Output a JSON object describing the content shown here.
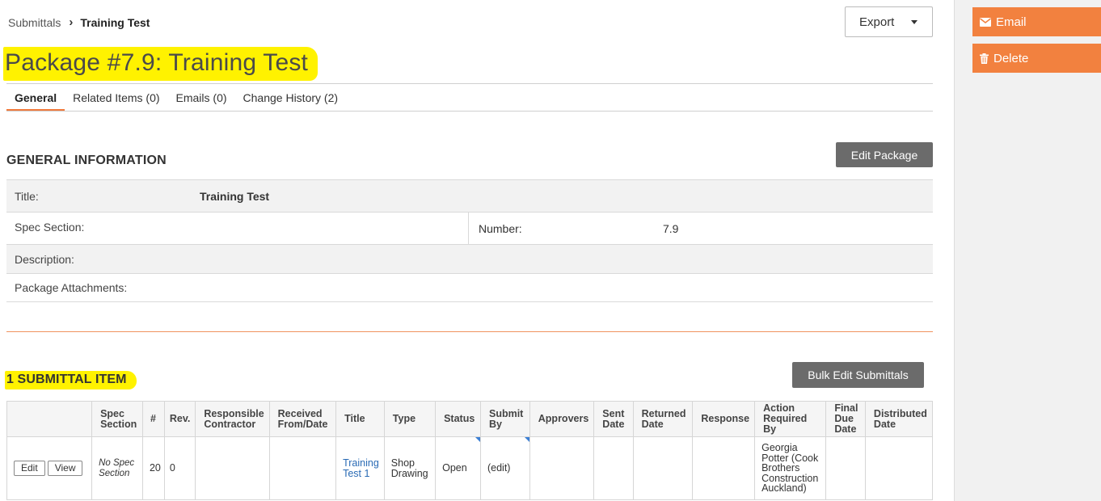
{
  "breadcrumb": {
    "parent": "Submittals",
    "current": "Training Test"
  },
  "export_label": "Export",
  "page_title": "Package #7.9: Training Test",
  "tabs": [
    {
      "label": "General"
    },
    {
      "label": "Related Items (0)"
    },
    {
      "label": "Emails (0)"
    },
    {
      "label": "Change History (2)"
    }
  ],
  "general": {
    "heading": "GENERAL INFORMATION",
    "edit_label": "Edit Package",
    "title_label": "Title:",
    "title_value": "Training Test",
    "spec_label": "Spec Section:",
    "number_label": "Number:",
    "number_value": "7.9",
    "description_label": "Description:",
    "attachments_label": "Package Attachments:"
  },
  "items": {
    "heading": "1 SUBMITTAL ITEM",
    "bulk_edit_label": "Bulk Edit Submittals",
    "columns": [
      "Spec Section",
      "#",
      "Rev.",
      "Responsible Contractor",
      "Received From/Date",
      "Title",
      "Type",
      "Status",
      "Submit By",
      "Approvers",
      "Sent Date",
      "Returned Date",
      "Response",
      "Action Required By",
      "Final Due Date",
      "Distributed Date"
    ],
    "row": {
      "edit": "Edit",
      "view": "View",
      "spec": "No Spec Section",
      "num": "20",
      "rev": "0",
      "responsible": "",
      "received": "",
      "title": "Training Test 1",
      "type": "Shop Drawing",
      "status": "Open",
      "submit_by": "(edit)",
      "approvers": "",
      "sent": "",
      "returned": "",
      "response": "",
      "action_by": "Georgia Potter (Cook Brothers Construction Auckland)",
      "final_due": "",
      "distributed": ""
    }
  },
  "sidebar": {
    "email_label": "Email",
    "delete_label": "Delete"
  },
  "colors": {
    "accent": "#f2813f",
    "highlight": "#fff200",
    "dark_button": "#6b6b6b",
    "link": "#2a6bb5"
  }
}
